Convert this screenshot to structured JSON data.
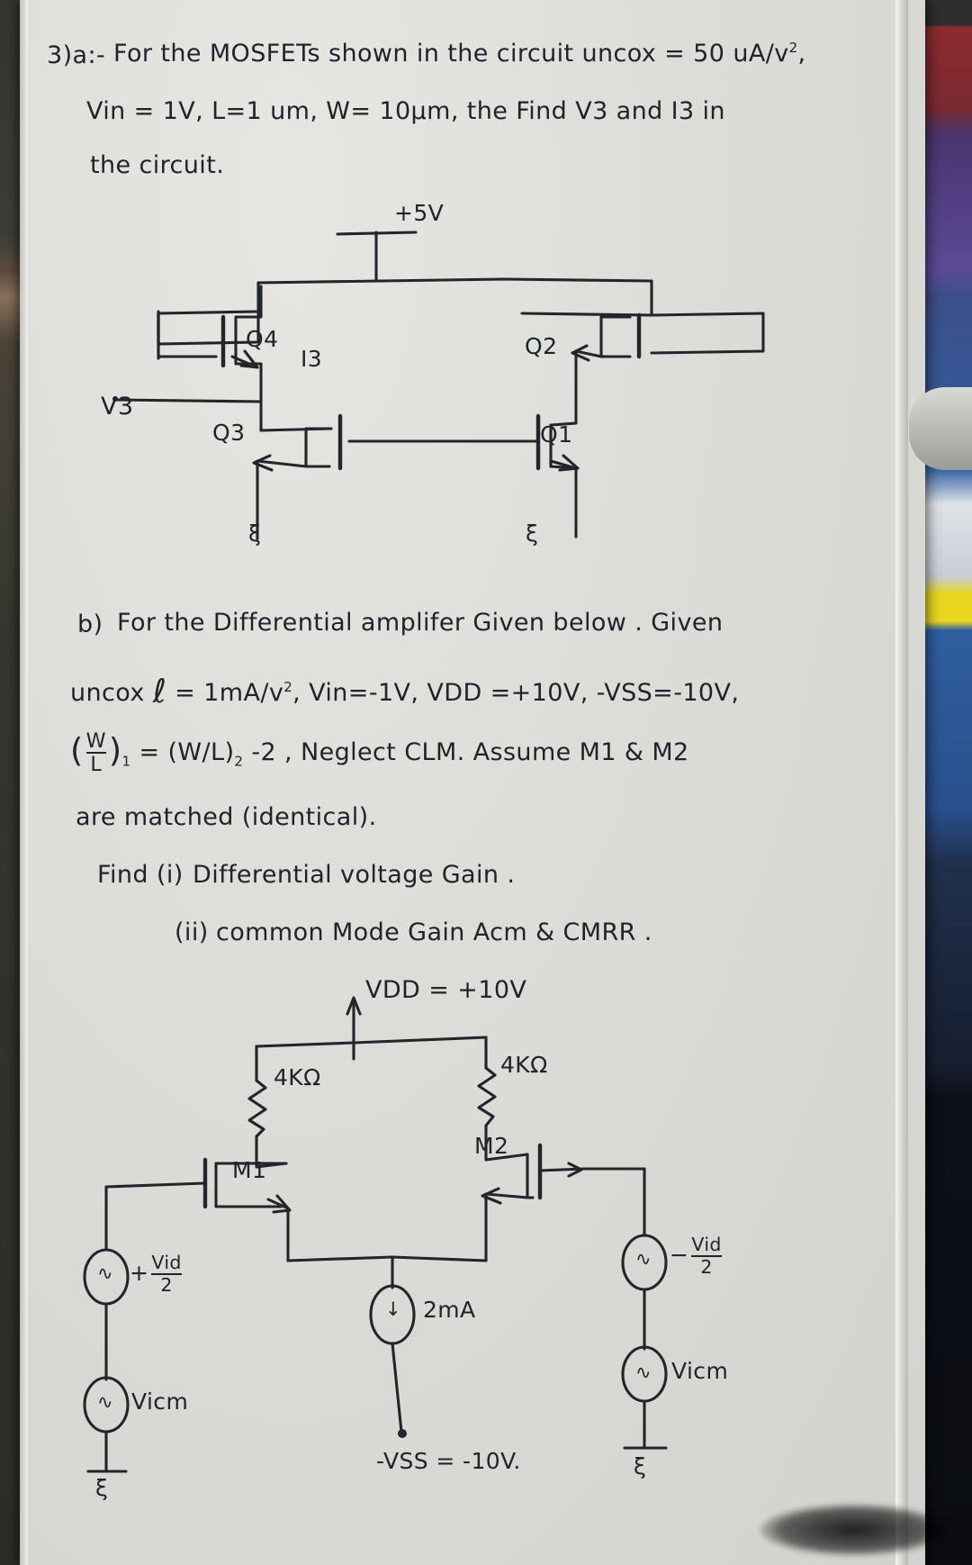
{
  "page": {
    "background_color": "#dcdcd8",
    "ink_color": "#20242a"
  },
  "question_a": {
    "label": "3)a:-",
    "line1": "For the MOSFETs shown in the circuit uncox = 50 uA/v",
    "line1_exp": "2",
    "line1_tail": ",",
    "line2": "Vin = 1V, L=1 um, W= 10µm, the Find V3 and I3 in",
    "line3": "the circuit."
  },
  "circuit_a": {
    "supply_label": "+5V",
    "current_label": "I3",
    "node_label": "V3",
    "devices": [
      {
        "name": "Q4"
      },
      {
        "name": "Q2"
      },
      {
        "name": "Q3"
      },
      {
        "name": "Q1"
      }
    ],
    "ground_symbol": "ξ"
  },
  "question_b": {
    "label": "b)",
    "line1": "For the Differential amplifer Given below . Given",
    "line2_pre": "uncox",
    "line2_ell": "ℓ",
    "line2_rest": "= 1mA/v",
    "line2_exp": "2",
    "line2_tail": ", Vin=-1V, VDD =+10V, -VSS=-10V,",
    "line3_frac_num": "W",
    "line3_frac_den": "L",
    "line3_sub1": "1",
    "line3_mid": "= (W/L)",
    "line3_sub2": "2",
    "line3_rest": "-2 , Neglect CLM. Assume M1 & M2",
    "line4": "are matched (identical).",
    "line5_pre": "Find (i)",
    "line5": "Differential voltage Gain .",
    "line6_pre": "(ii)",
    "line6": "common Mode Gain  Acm & CMRR ."
  },
  "circuit_b": {
    "vdd_label": "VDD = +10V",
    "resistor_left": "4KΩ",
    "resistor_right": "4KΩ",
    "transistor_left": "M1",
    "transistor_right": "M2",
    "source_left_sign": "+",
    "source_left_num": "Vid",
    "source_left_den": "2",
    "source_right_sign": "−",
    "source_right_num": "Vid",
    "source_right_den": "2",
    "vicm_left": "Vicm",
    "vicm_right": "Vicm",
    "current_source": "2mA",
    "vss_label": "-VSS = -10V.",
    "ground_symbol": "ξ",
    "source_glyph": "∿",
    "current_glyph": "↓"
  }
}
